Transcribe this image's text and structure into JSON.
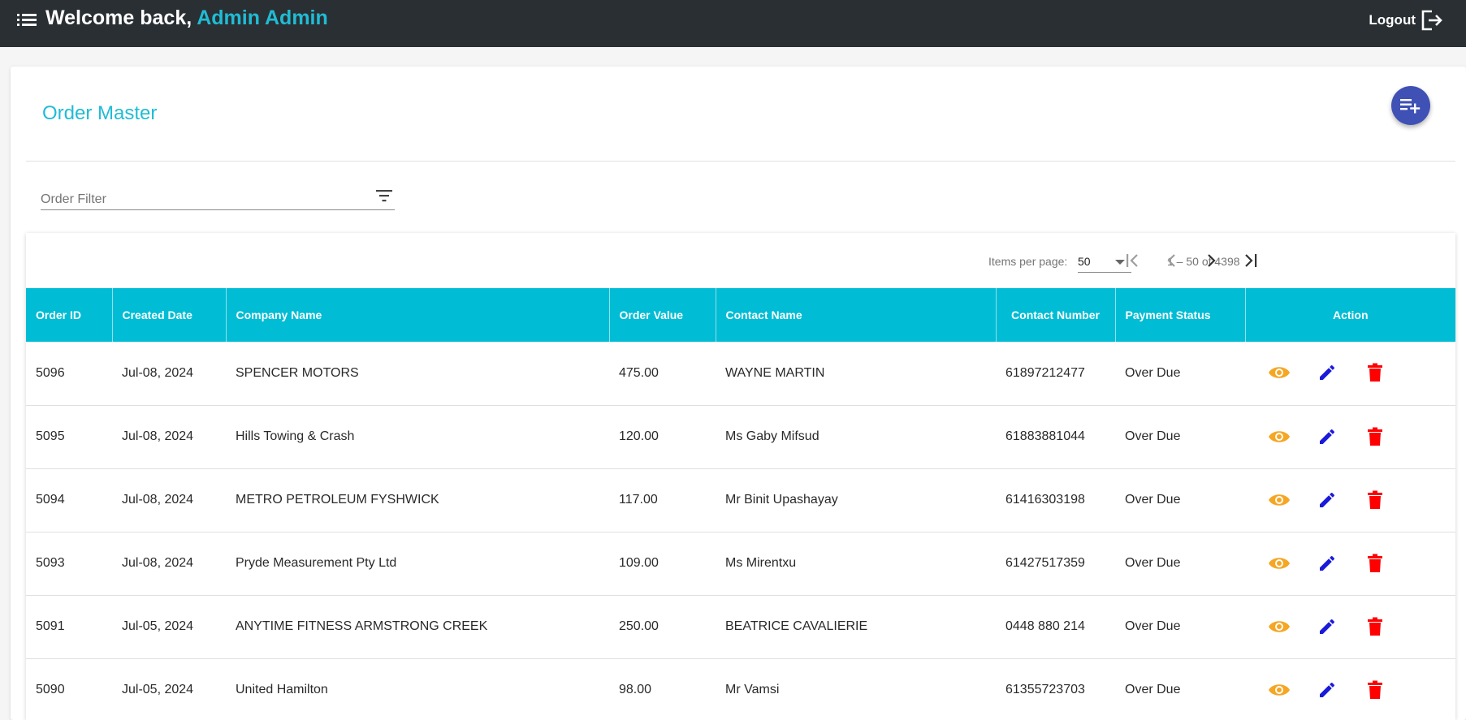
{
  "header": {
    "welcome_prefix": "Welcome back, ",
    "user_name": "Admin Admin",
    "logout_label": "Logout",
    "accent": "#20bcd4",
    "background": "#2a2f33"
  },
  "page": {
    "title": "Order Master",
    "add_button_icon": "playlist-add-icon"
  },
  "filter": {
    "placeholder": "Order Filter",
    "value": "",
    "icon": "filter-list-icon"
  },
  "paginator": {
    "items_per_page_label": "Items per page:",
    "items_per_page_value": "50",
    "range_label": "1 – 50 of 4398"
  },
  "table": {
    "header_color": "#00bcd4",
    "columns": [
      "Order ID",
      "Created Date",
      "Company Name",
      "Order Value",
      "Contact Name",
      "Contact Number",
      "Payment Status",
      "Action"
    ],
    "rows": [
      {
        "order_id": "5096",
        "created": "Jul-08, 2024",
        "company": "SPENCER MOTORS",
        "value": "475.00",
        "contact": "WAYNE MARTIN",
        "phone": "61897212477",
        "status": "Over Due"
      },
      {
        "order_id": "5095",
        "created": "Jul-08, 2024",
        "company": "Hills Towing & Crash",
        "value": "120.00",
        "contact": "Ms Gaby Mifsud",
        "phone": "61883881044",
        "status": "Over Due"
      },
      {
        "order_id": "5094",
        "created": "Jul-08, 2024",
        "company": "METRO PETROLEUM FYSHWICK",
        "value": "117.00",
        "contact": "Mr Binit Upashayay",
        "phone": "61416303198",
        "status": "Over Due"
      },
      {
        "order_id": "5093",
        "created": "Jul-08, 2024",
        "company": "Pryde Measurement Pty Ltd",
        "value": "109.00",
        "contact": "Ms Mirentxu",
        "phone": "61427517359",
        "status": "Over Due"
      },
      {
        "order_id": "5091",
        "created": "Jul-05, 2024",
        "company": "ANYTIME FITNESS ARMSTRONG CREEK",
        "value": "250.00",
        "contact": "BEATRICE CAVALIERIE",
        "phone": "0448 880 214",
        "status": "Over Due"
      },
      {
        "order_id": "5090",
        "created": "Jul-05, 2024",
        "company": "United Hamilton",
        "value": "98.00",
        "contact": "Mr Vamsi",
        "phone": "61355723703",
        "status": "Over Due"
      }
    ],
    "action_icons": {
      "view": "eye-icon",
      "edit": "pencil-icon",
      "delete": "trash-icon"
    },
    "action_colors": {
      "view": "#f5a623",
      "edit": "#1a1adb",
      "delete": "#ff0000"
    }
  }
}
